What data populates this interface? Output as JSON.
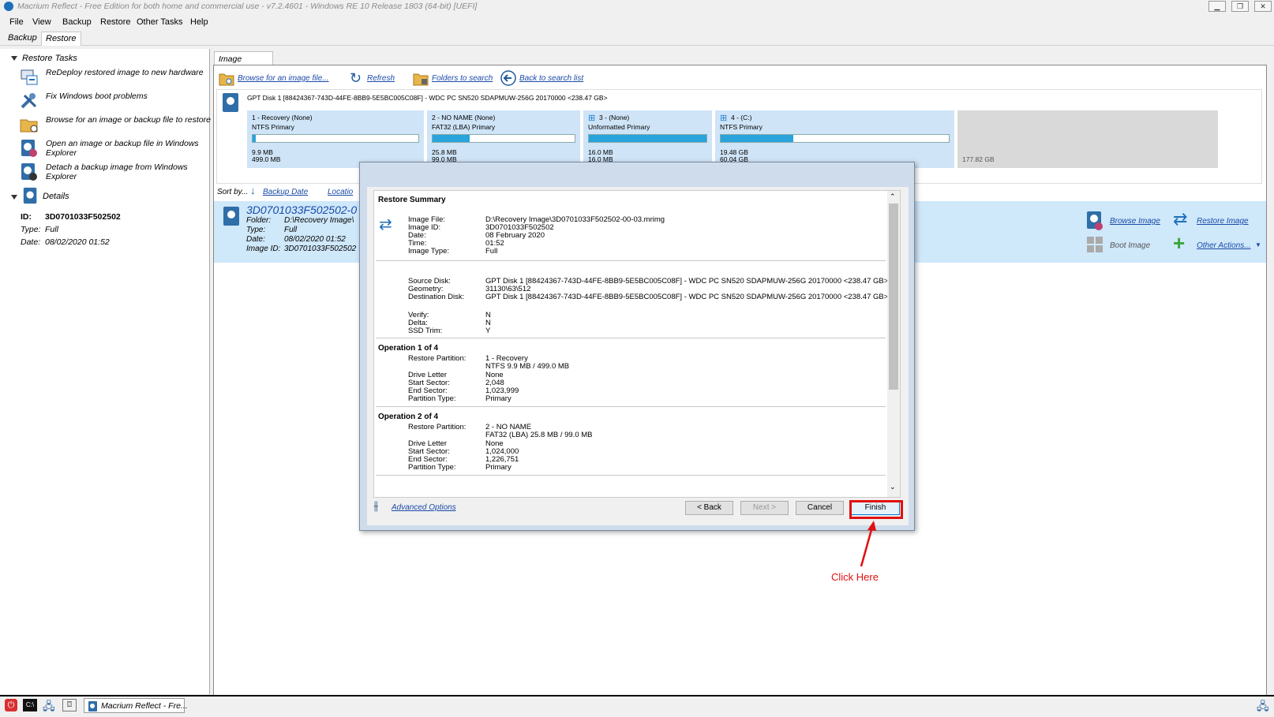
{
  "window": {
    "title": "Macrium Reflect - Free Edition for both home and commercial use - v7.2.4601 - Windows RE 10 Release 1803 (64-bit) [UEFI]"
  },
  "menu": [
    "File",
    "View",
    "Backup",
    "Restore",
    "Other Tasks",
    "Help"
  ],
  "tabs": [
    "Backup",
    "Restore"
  ],
  "left": {
    "restore_tasks_header": "Restore Tasks",
    "tasks": [
      "ReDeploy restored image to new hardware",
      "Fix Windows boot problems",
      "Browse for an image or backup file to restore",
      "Open an image or backup file in Windows Explorer",
      "Detach a backup image from Windows Explorer"
    ],
    "details_header": "Details",
    "details": {
      "id_label": "ID:",
      "id_value": "3D0701033F502502",
      "type_label": "Type:",
      "type_value": "Full",
      "date_label": "Date:",
      "date_value": "08/02/2020 01:52"
    }
  },
  "main": {
    "tab_label": "Image Restore",
    "toolbar": {
      "browse": "Browse for an image file...",
      "refresh": "Refresh",
      "folders": "Folders to search",
      "back": "Back to search list"
    },
    "disk_title": "GPT Disk 1 [88424367-743D-44FE-8BB9-5E5BC005C08F] - WDC PC SN520 SDAPMUW-256G 20170000  <238.47 GB>",
    "partitions": [
      {
        "name": "1 - Recovery (None)",
        "fs": "NTFS Primary",
        "used": "9.9 MB",
        "size": "499.0 MB",
        "fill": 0.02
      },
      {
        "name": "2 - NO NAME (None)",
        "fs": "FAT32 (LBA) Primary",
        "used": "25.8 MB",
        "size": "99.0 MB",
        "fill": 0.26
      },
      {
        "name": "3 - (None)",
        "fs": "Unformatted Primary",
        "used": "16.0 MB",
        "size": "16.0 MB",
        "fill": 1.0
      },
      {
        "name": "4 - (C:)",
        "fs": "NTFS Primary",
        "used": "19.48 GB",
        "size": "60.04 GB",
        "fill": 0.32
      }
    ],
    "unallocated": "177.82 GB",
    "sort_label": "Sort by...",
    "sort_backup_date": "Backup Date",
    "sort_location": "Locatio",
    "backup": {
      "id_title": "3D0701033F502502-0",
      "folder_label": "Folder:",
      "folder_value": "D:\\Recovery Image\\",
      "type_label": "Type:",
      "type_value": "Full",
      "date_label": "Date:",
      "date_value": "08/02/2020 01:52",
      "imageid_label": "Image ID:",
      "imageid_value": "3D0701033F502502"
    },
    "actions": {
      "browse_image": "Browse Image",
      "restore_image": "Restore Image",
      "boot_image": "Boot Image",
      "other_actions": "Other Actions..."
    }
  },
  "dialog": {
    "heading": "Restore Summary",
    "image": [
      {
        "label": "Image File:",
        "value": "D:\\Recovery Image\\3D0701033F502502-00-03.mrimg"
      },
      {
        "label": "Image ID:",
        "value": "3D0701033F502502"
      },
      {
        "label": "Date:",
        "value": "08 February 2020"
      },
      {
        "label": "Time:",
        "value": "01:52"
      },
      {
        "label": "Image Type:",
        "value": "Full"
      }
    ],
    "disk": [
      {
        "label": "Source Disk:",
        "value": "GPT Disk 1 [88424367-743D-44FE-8BB9-5E5BC005C08F] - WDC PC SN520 SDAPMUW-256G 20170000  <238.47 GB>"
      },
      {
        "label": "Geometry:",
        "value": "31130\\63\\512"
      },
      {
        "label": "Destination Disk:",
        "value": "GPT Disk 1 [88424367-743D-44FE-8BB9-5E5BC005C08F] - WDC PC SN520 SDAPMUW-256G 20170000  <238.47 GB>"
      }
    ],
    "options": [
      {
        "label": "Verify:",
        "value": "N"
      },
      {
        "label": "Delta:",
        "value": "N"
      },
      {
        "label": "SSD Trim:",
        "value": "Y"
      }
    ],
    "op1": {
      "title": "Operation 1 of 4",
      "restore_label": "Restore Partition:",
      "restore_value": "1 - Recovery",
      "restore_value2": "NTFS 9.9 MB / 499.0 MB",
      "drive_label": "Drive Letter",
      "drive_value": "None",
      "start_label": "Start Sector:",
      "start_value": "2,048",
      "end_label": "End Sector:",
      "end_value": "1,023,999",
      "ptype_label": "Partition Type:",
      "ptype_value": "Primary"
    },
    "op2": {
      "title": "Operation 2 of 4",
      "restore_label": "Restore Partition:",
      "restore_value": "2 - NO NAME",
      "restore_value2": "FAT32 (LBA) 25.8 MB / 99.0 MB",
      "drive_label": "Drive Letter",
      "drive_value": "None",
      "start_label": "Start Sector:",
      "start_value": "1,024,000",
      "end_label": "End Sector:",
      "end_value": "1,226,751",
      "ptype_label": "Partition Type:",
      "ptype_value": "Primary"
    },
    "advanced_options": "Advanced Options",
    "back": "< Back",
    "next": "Next >",
    "cancel": "Cancel",
    "finish": "Finish"
  },
  "annotation": {
    "text": "Click Here",
    "color": "#e01010"
  },
  "taskbar": {
    "app_label": "Macrium Reflect - Fre..."
  }
}
